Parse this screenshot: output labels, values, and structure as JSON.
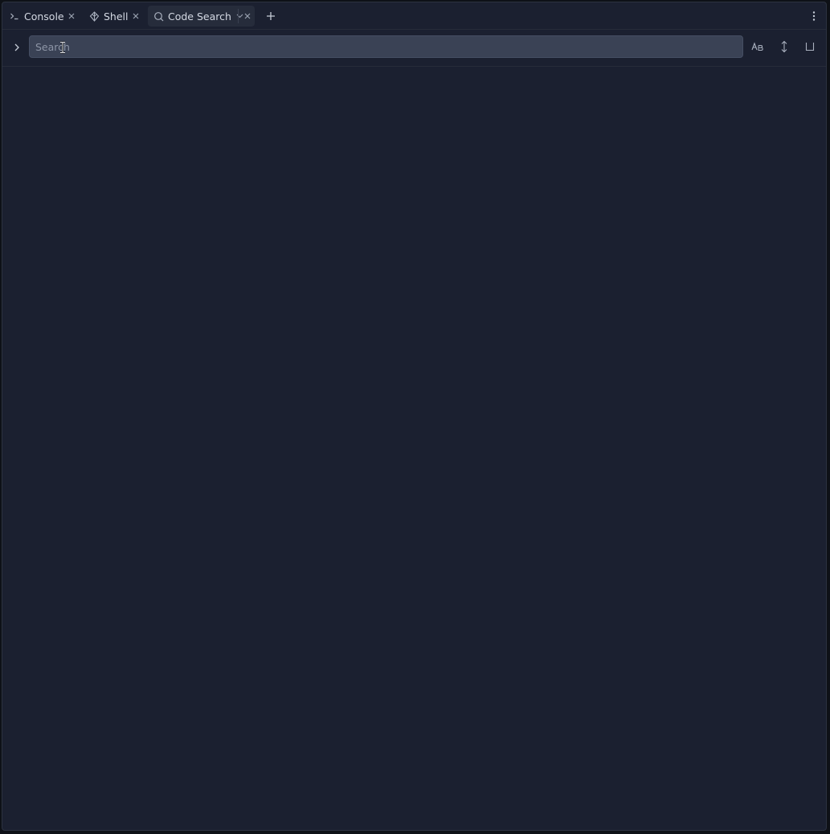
{
  "tabs": [
    {
      "label": "Console",
      "icon": "terminal-icon",
      "closable": true,
      "active": false
    },
    {
      "label": "Shell",
      "icon": "shell-icon",
      "closable": true,
      "active": false
    },
    {
      "label": "Code Search",
      "icon": "search-icon",
      "closable": true,
      "active": true,
      "has_dropdown": true
    }
  ],
  "search": {
    "placeholder": "Search",
    "value": ""
  },
  "toolbar": {
    "tools": [
      "match-case-icon",
      "expand-collapse-icon",
      "open-panel-icon"
    ]
  },
  "colors": {
    "background": "#1b2030",
    "input_background": "#3a4255",
    "text": "#d4d9e3"
  }
}
